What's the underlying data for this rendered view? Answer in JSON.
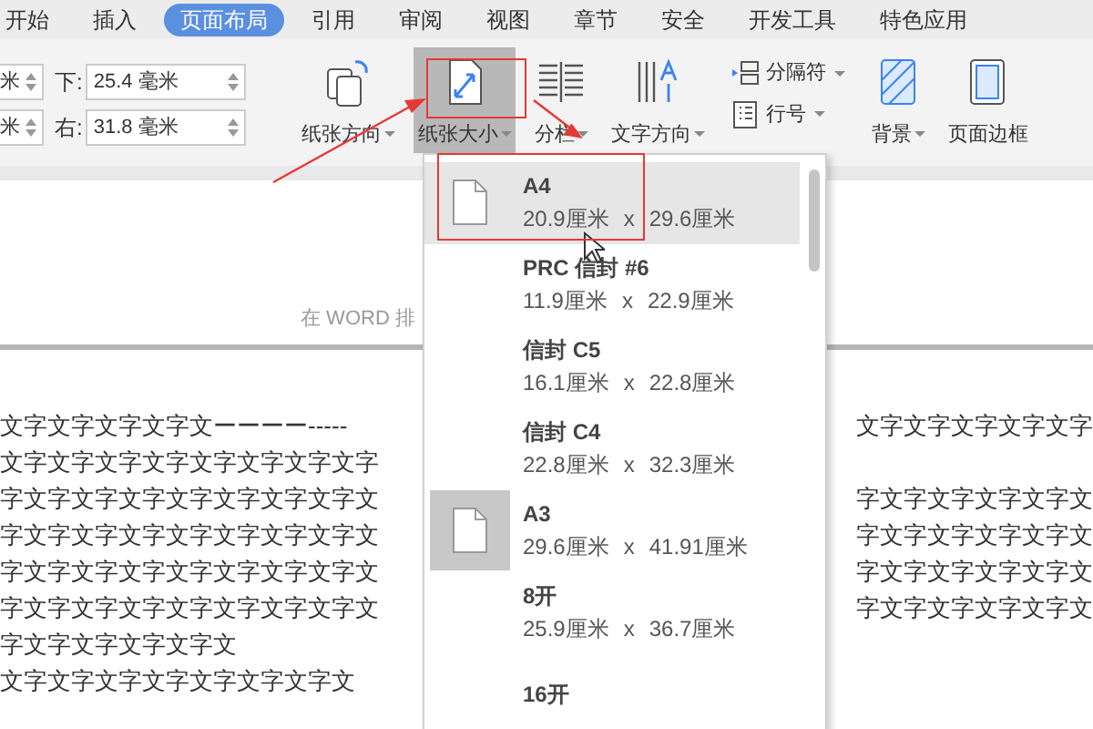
{
  "tabs": [
    {
      "label": "开始",
      "selected": false
    },
    {
      "label": "插入",
      "selected": false
    },
    {
      "label": "页面布局",
      "selected": true
    },
    {
      "label": "引用",
      "selected": false
    },
    {
      "label": "审阅",
      "selected": false
    },
    {
      "label": "视图",
      "selected": false
    },
    {
      "label": "章节",
      "selected": false
    },
    {
      "label": "安全",
      "selected": false
    },
    {
      "label": "开发工具",
      "selected": false
    },
    {
      "label": "特色应用",
      "selected": false
    }
  ],
  "margins": [
    {
      "value": "米"
    },
    {
      "value": "米"
    },
    {
      "label": "下:",
      "value": "25.4 毫米"
    },
    {
      "label": "右:",
      "value": "31.8 毫米"
    }
  ],
  "ribbon": [
    {
      "kind": "big",
      "label": "纸张方向",
      "caret": true,
      "pressed": false
    },
    {
      "kind": "big",
      "label": "纸张大小",
      "caret": true,
      "pressed": true
    },
    {
      "kind": "big",
      "label": "分栏",
      "caret": true,
      "pressed": false
    },
    {
      "kind": "big",
      "label": "文字方向",
      "caret": true,
      "pressed": false
    },
    {
      "kind": "stack",
      "items": [
        {
          "label": "分隔符"
        },
        {
          "label": "行号"
        }
      ]
    },
    {
      "kind": "big",
      "label": "背景",
      "caret": true,
      "pressed": false
    },
    {
      "kind": "big",
      "label": "页面边框",
      "caret": false,
      "pressed": false
    }
  ],
  "document": {
    "header": "在 WORD 排",
    "lines": [
      {
        "left": "文字文字文字文字文ーーーー-----",
        "right": "文字文字文字文字文字"
      },
      {
        "left": "文字文字文字文字文字文字文字文字"
      },
      {
        "left": "字文字文字文字文字文字文字文字文",
        "right": "字文字文字文字文字文"
      },
      {
        "left": "字文字文字文字文字文字文字文字文",
        "right": "字文字文字文字文字文"
      },
      {
        "left": "字文字文字文字文字文字文字文字文",
        "right": "字文字文字文字文字文"
      },
      {
        "left": "字文字文字文字文字文字文字文字文",
        "right": "字文字文字文字文字文"
      },
      {
        "left": "字文字文字文字文字文"
      },
      {
        "left": "文字文字文字文字文字文字文字文"
      }
    ]
  },
  "paper_menu": {
    "items": [
      {
        "kind": "plain-thumbnail",
        "name": "A4",
        "width": "20.9厘米",
        "x": "x",
        "height": "29.6厘米",
        "selected": true
      },
      {
        "kind": "text",
        "name": "PRC 信封 #6",
        "width": "11.9厘米",
        "x": "x",
        "height": "22.9厘米",
        "selected": false
      },
      {
        "kind": "text",
        "name": "信封 C5",
        "width": "16.1厘米",
        "x": "x",
        "height": "22.8厘米",
        "selected": false
      },
      {
        "kind": "text",
        "name": "信封 C4",
        "width": "22.8厘米",
        "x": "x",
        "height": "32.3厘米",
        "selected": false
      },
      {
        "kind": "shaded-thumbnail",
        "name": "A3",
        "width": "29.6厘米",
        "x": "x",
        "height": "41.91厘米",
        "selected": false
      },
      {
        "kind": "text",
        "name": "8开",
        "width": "25.9厘米",
        "x": "x",
        "height": "36.7厘米",
        "selected": false
      },
      {
        "kind": "text",
        "name": "16开",
        "selected": false
      }
    ]
  }
}
